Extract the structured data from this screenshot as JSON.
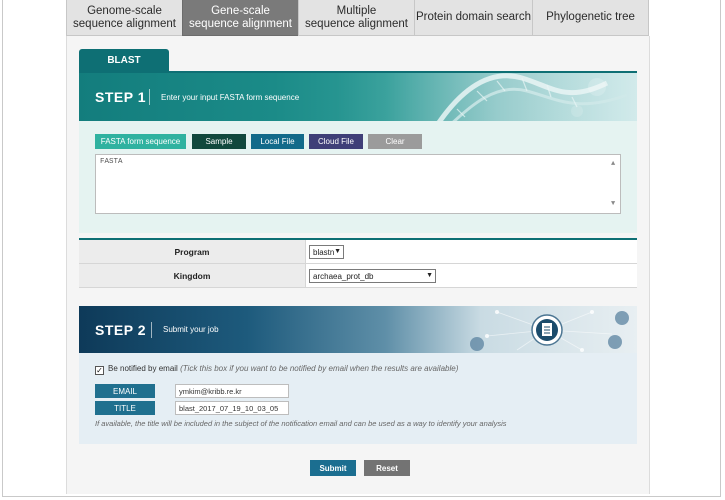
{
  "tabs": [
    {
      "label": "Genome-scale\nsequence alignment",
      "active": false
    },
    {
      "label": "Gene-scale\nsequence alignment",
      "active": true
    },
    {
      "label": "Multiple\nsequence alignment",
      "active": false
    },
    {
      "label": "Protein domain search",
      "active": false
    },
    {
      "label": "Phylogenetic tree",
      "active": false
    }
  ],
  "tool_tab": "BLAST",
  "step1": {
    "title": "STEP 1",
    "description": "Enter your input FASTA form sequence",
    "buttons": {
      "fasta": "FASTA form sequence",
      "sample": "Sample",
      "local_file": "Local File",
      "cloud_file": "Cloud File",
      "clear": "Clear"
    },
    "sequence_text": "FASTA"
  },
  "params": {
    "program_label": "Program",
    "program_value": "blastn",
    "kingdom_label": "Kingdom",
    "kingdom_value": "archaea_prot_db"
  },
  "step2": {
    "title": "STEP 2",
    "description": "Submit your job",
    "notify_label": "Be notified by email",
    "notify_hint": "(Tick this box if you want to be notified by email when the results are available)",
    "notify_checked": true,
    "email_label": "EMAIL",
    "email_value": "ymkim@kribb.re.kr",
    "title_label": "TITLE",
    "title_value": "blast_2017_07_19_10_03_05",
    "footnote": "If available, the title will be included in the subject of the notification email and can be used as a way to identify your analysis"
  },
  "actions": {
    "submit": "Submit",
    "reset": "Reset"
  },
  "colors": {
    "teal": "#0e6f74",
    "navy": "#1b6e90",
    "tab_active": "#7a7a7a"
  }
}
